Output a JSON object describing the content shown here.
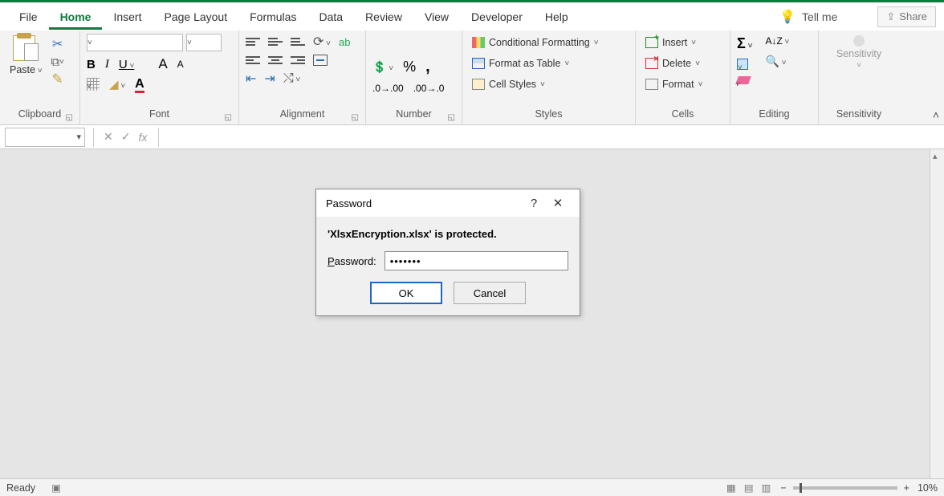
{
  "menu": {
    "tabs": [
      "File",
      "Home",
      "Insert",
      "Page Layout",
      "Formulas",
      "Data",
      "Review",
      "View",
      "Developer",
      "Help"
    ],
    "active": "Home",
    "tell_me": "Tell me",
    "share": "Share"
  },
  "ribbon": {
    "clipboard": {
      "paste": "Paste",
      "label": "Clipboard"
    },
    "font": {
      "label": "Font",
      "bold": "B",
      "italic": "I",
      "underline": "U",
      "grow": "A",
      "shrink": "A",
      "font_color": "A"
    },
    "alignment": {
      "label": "Alignment",
      "wrap": "ab"
    },
    "number": {
      "label": "Number",
      "percent": "%",
      "comma": ",",
      "inc_dec": ".0",
      "dec_dec": ".00"
    },
    "styles": {
      "label": "Styles",
      "cf": "Conditional Formatting",
      "fat": "Format as Table",
      "cs": "Cell Styles"
    },
    "cells": {
      "label": "Cells",
      "insert": "Insert",
      "delete": "Delete",
      "format": "Format"
    },
    "editing": {
      "label": "Editing"
    },
    "sensitivity": {
      "label": "Sensitivity",
      "btn": "Sensitivity"
    }
  },
  "formula_bar": {
    "fx": "fx"
  },
  "dialog": {
    "title": "Password",
    "message": "'XlsxEncryption.xlsx' is protected.",
    "pw_label_underlined": "P",
    "pw_label_rest": "assword:",
    "pw_value": "•••••••",
    "ok": "OK",
    "cancel": "Cancel"
  },
  "status": {
    "ready": "Ready",
    "zoom": "10%"
  }
}
